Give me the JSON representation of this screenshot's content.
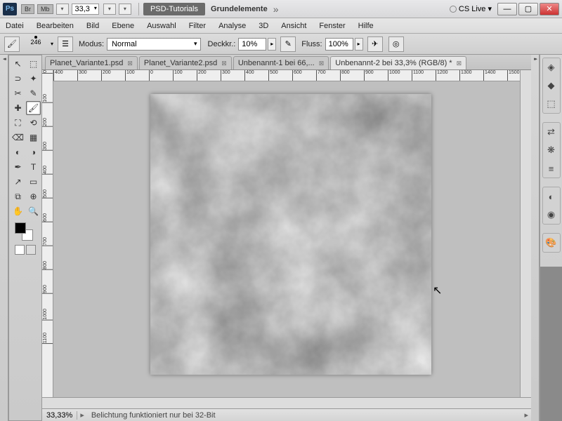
{
  "titlebar": {
    "badges": [
      "Br",
      "Mb"
    ],
    "zoom": "33,3",
    "project": "PSD-Tutorials",
    "document": "Grundelemente",
    "cslive": "CS Live"
  },
  "menu": [
    "Datei",
    "Bearbeiten",
    "Bild",
    "Ebene",
    "Auswahl",
    "Filter",
    "Analyse",
    "3D",
    "Ansicht",
    "Fenster",
    "Hilfe"
  ],
  "options": {
    "brush_size": "246",
    "mode_label": "Modus:",
    "mode_value": "Normal",
    "opacity_label": "Deckkr.:",
    "opacity_value": "10%",
    "flow_label": "Fluss:",
    "flow_value": "100%"
  },
  "tabs": [
    {
      "label": "Planet_Variante1.psd",
      "active": false
    },
    {
      "label": "Planet_Variante2.psd",
      "active": false
    },
    {
      "label": "Unbenannt-1 bei 66,...",
      "active": false
    },
    {
      "label": "Unbenannt-2 bei 33,3% (RGB/8) *",
      "active": true
    }
  ],
  "ruler_h": [
    "400",
    "300",
    "200",
    "100",
    "0",
    "100",
    "200",
    "300",
    "400",
    "500",
    "600",
    "700",
    "800",
    "900",
    "1000",
    "1100",
    "1200",
    "1300",
    "1400",
    "1500"
  ],
  "ruler_v": [
    "0",
    "100",
    "200",
    "300",
    "400",
    "500",
    "600",
    "700",
    "800",
    "900",
    "1000",
    "1100"
  ],
  "status": {
    "zoom": "33,33%",
    "message": "Belichtung funktioniert nur bei 32-Bit"
  },
  "tools": [
    {
      "icon": "↖",
      "name": "move-tool"
    },
    {
      "icon": "⬚",
      "name": "marquee-tool"
    },
    {
      "icon": "⊃",
      "name": "lasso-tool"
    },
    {
      "icon": "✦",
      "name": "wand-tool"
    },
    {
      "icon": "✂",
      "name": "crop-tool"
    },
    {
      "icon": "✎",
      "name": "eyedropper-tool"
    },
    {
      "icon": "✚",
      "name": "heal-tool"
    },
    {
      "icon": "🖌",
      "name": "brush-tool",
      "active": true
    },
    {
      "icon": "⛶",
      "name": "stamp-tool"
    },
    {
      "icon": "⟲",
      "name": "history-brush-tool"
    },
    {
      "icon": "⌫",
      "name": "eraser-tool"
    },
    {
      "icon": "▦",
      "name": "gradient-tool"
    },
    {
      "icon": "◐",
      "name": "blur-tool"
    },
    {
      "icon": "◑",
      "name": "dodge-tool"
    },
    {
      "icon": "✒",
      "name": "pen-tool"
    },
    {
      "icon": "T",
      "name": "type-tool"
    },
    {
      "icon": "↗",
      "name": "path-tool"
    },
    {
      "icon": "▭",
      "name": "shape-tool"
    },
    {
      "icon": "⧉",
      "name": "3d-tool"
    },
    {
      "icon": "⊕",
      "name": "3d-camera-tool"
    },
    {
      "icon": "✋",
      "name": "hand-tool"
    },
    {
      "icon": "🔍",
      "name": "zoom-tool"
    }
  ],
  "panel_icons": [
    [
      "◈",
      "◆",
      "⬚"
    ],
    [
      "⇄",
      "❋",
      "≡"
    ],
    [
      "◐",
      "◉"
    ],
    [
      "🎨"
    ]
  ],
  "winbuttons": {
    "min": "—",
    "max": "▢",
    "close": "✕"
  }
}
